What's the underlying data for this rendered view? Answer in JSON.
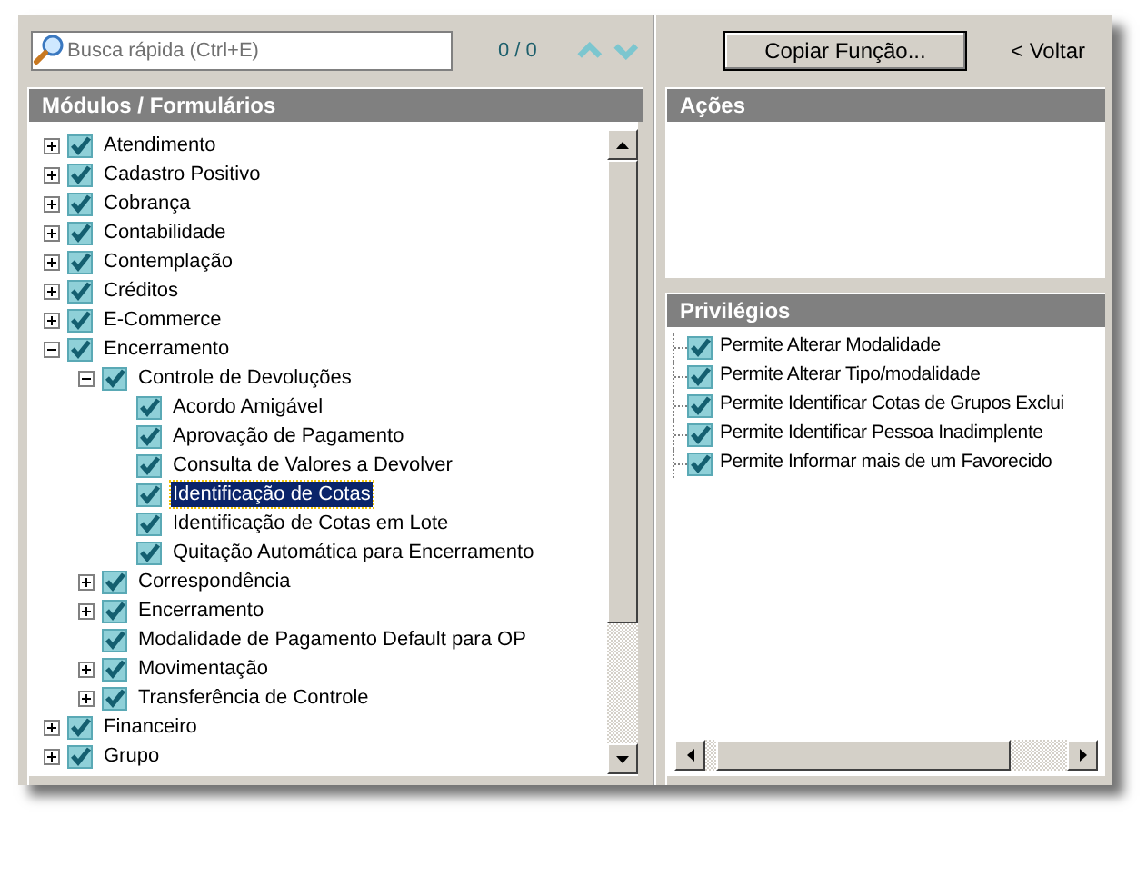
{
  "search": {
    "placeholder": "Busca rápida (Ctrl+E)",
    "count": "0 / 0"
  },
  "toolbar": {
    "copy_button": "Copiar Função...",
    "back_link": "< Voltar"
  },
  "modules": {
    "title": "Módulos / Formulários",
    "tree": [
      {
        "label": "Atendimento",
        "checked": true,
        "expanded": false,
        "selected": false
      },
      {
        "label": "Cadastro Positivo",
        "checked": true,
        "expanded": false,
        "selected": false
      },
      {
        "label": "Cobrança",
        "checked": true,
        "expanded": false,
        "selected": false
      },
      {
        "label": "Contabilidade",
        "checked": true,
        "expanded": false,
        "selected": false
      },
      {
        "label": "Contemplação",
        "checked": true,
        "expanded": false,
        "selected": false
      },
      {
        "label": "Créditos",
        "checked": true,
        "expanded": false,
        "selected": false
      },
      {
        "label": "E-Commerce",
        "checked": true,
        "expanded": false,
        "selected": false
      },
      {
        "label": "Encerramento",
        "checked": true,
        "expanded": true,
        "selected": false,
        "children": [
          {
            "label": "Controle de Devoluções",
            "checked": true,
            "expanded": true,
            "selected": false,
            "children": [
              {
                "label": "Acordo Amigável",
                "checked": true,
                "selected": false
              },
              {
                "label": "Aprovação de Pagamento",
                "checked": true,
                "selected": false
              },
              {
                "label": "Consulta de Valores a Devolver",
                "checked": true,
                "selected": false
              },
              {
                "label": "Identificação de Cotas",
                "checked": true,
                "selected": true
              },
              {
                "label": "Identificação de Cotas em Lote",
                "checked": true,
                "selected": false
              },
              {
                "label": "Quitação Automática para Encerramento",
                "checked": true,
                "selected": false
              }
            ]
          },
          {
            "label": "Correspondência",
            "checked": true,
            "expanded": false,
            "selected": false
          },
          {
            "label": "Encerramento",
            "checked": true,
            "expanded": false,
            "selected": false
          },
          {
            "label": "Modalidade de Pagamento Default para OP",
            "checked": true,
            "selected": false
          },
          {
            "label": "Movimentação",
            "checked": true,
            "expanded": false,
            "selected": false
          },
          {
            "label": "Transferência de Controle",
            "checked": true,
            "expanded": false,
            "selected": false
          }
        ]
      },
      {
        "label": "Financeiro",
        "checked": true,
        "expanded": false,
        "selected": false
      },
      {
        "label": "Grupo",
        "checked": true,
        "expanded": false,
        "selected": false
      }
    ]
  },
  "actions": {
    "title": "Ações"
  },
  "privileges": {
    "title": "Privilégios",
    "items": [
      {
        "label": "Permite Alterar Modalidade",
        "checked": true
      },
      {
        "label": "Permite Alterar Tipo/modalidade",
        "checked": true
      },
      {
        "label": "Permite Identificar Cotas de Grupos Exclui",
        "checked": true
      },
      {
        "label": "Permite Identificar Pessoa Inadimplente",
        "checked": true
      },
      {
        "label": "Permite Informar mais de um Favorecido",
        "checked": true
      }
    ]
  }
}
